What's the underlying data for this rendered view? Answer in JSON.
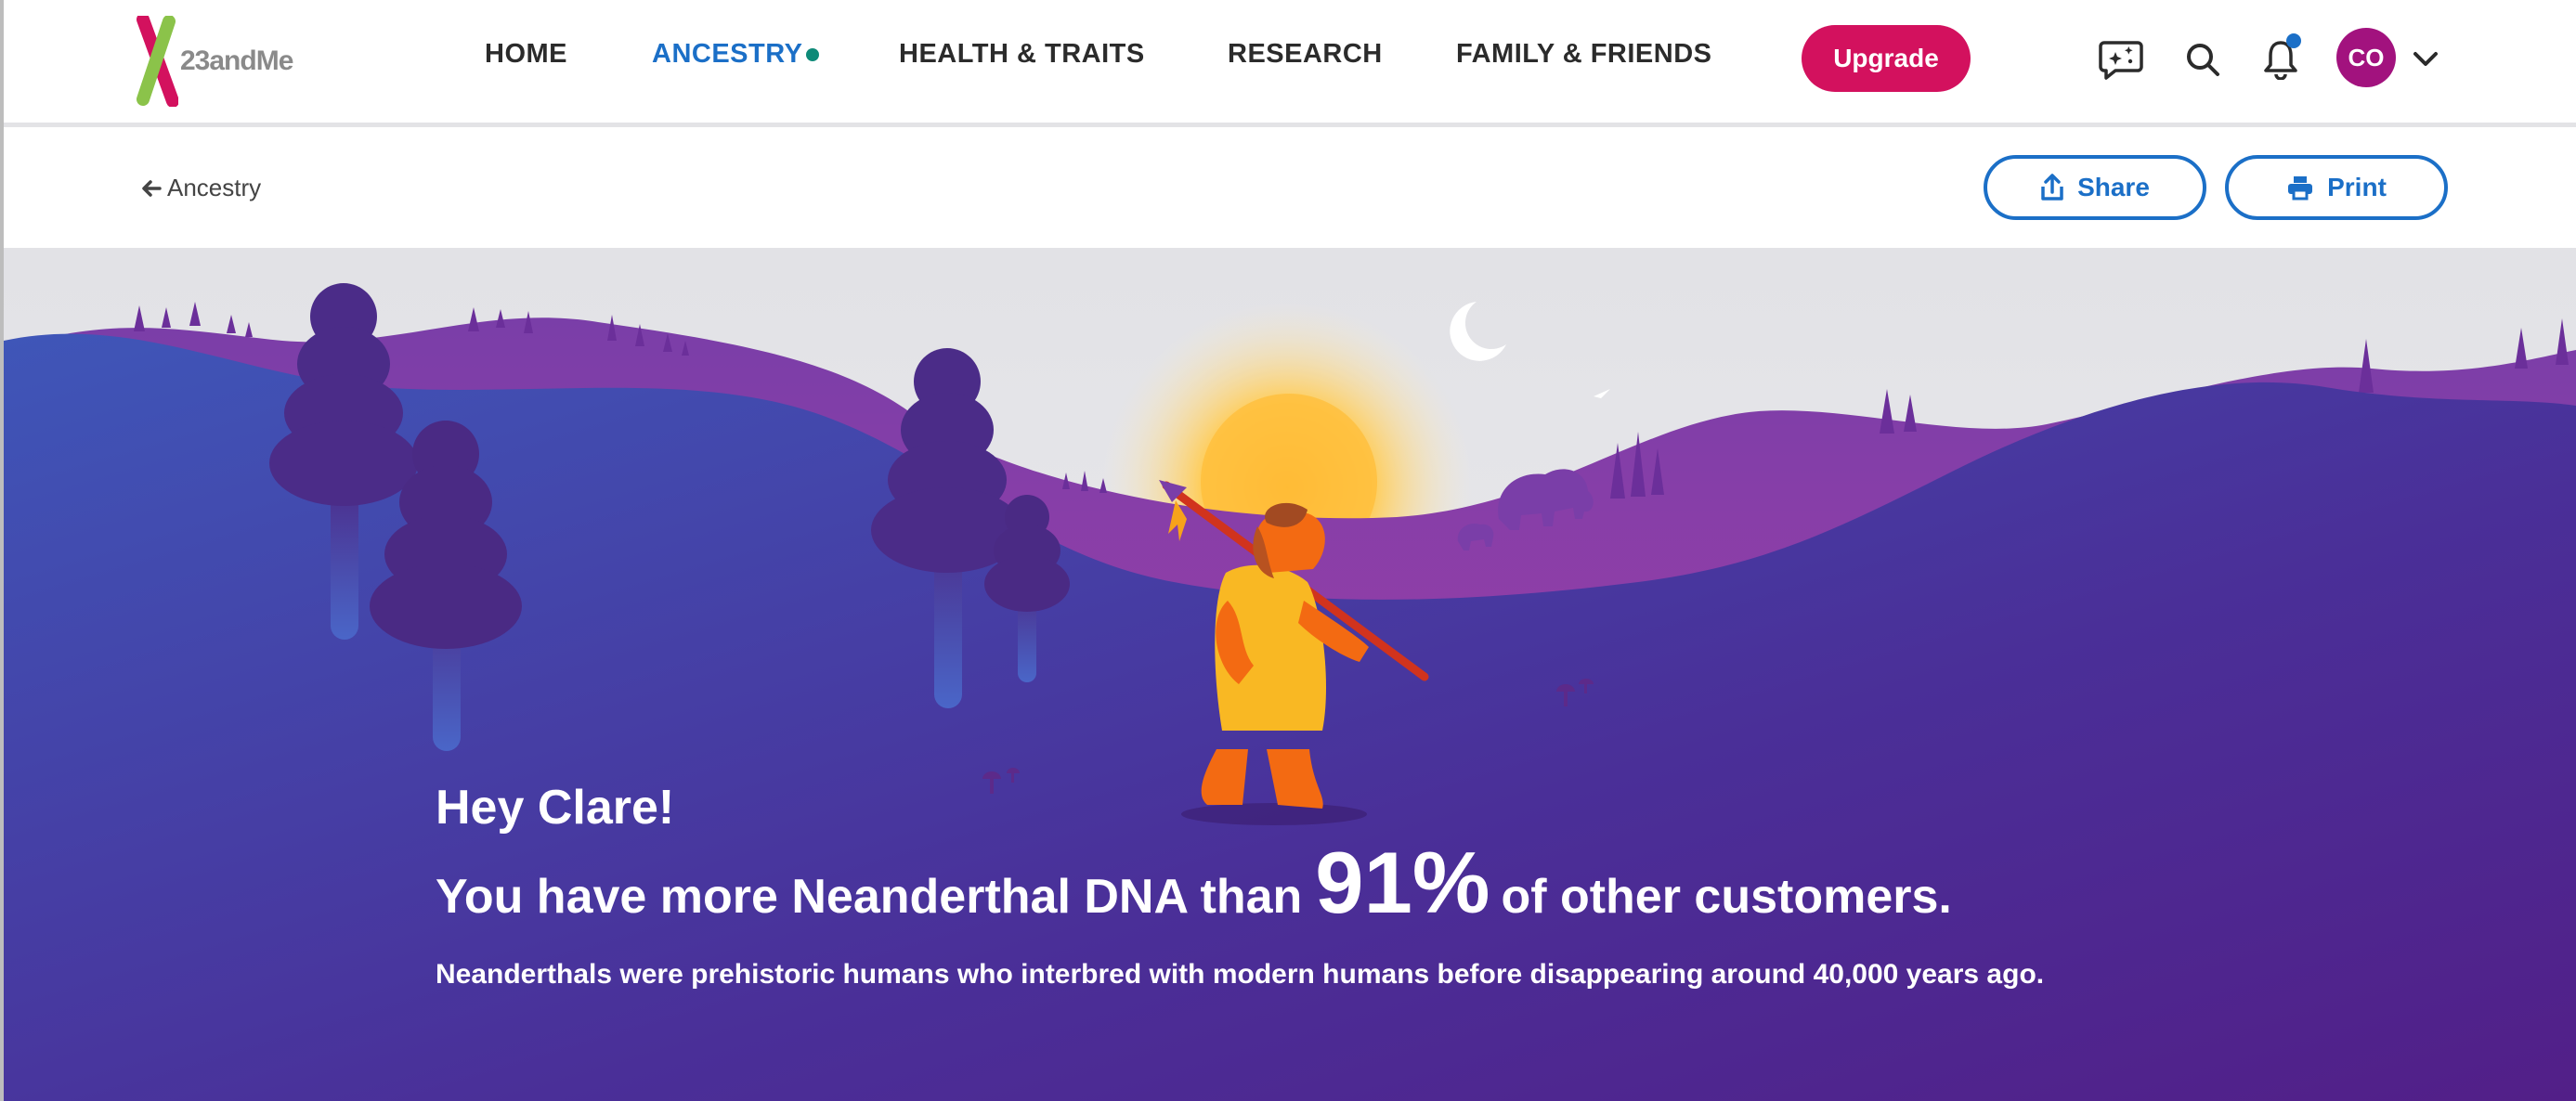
{
  "brand": {
    "name": "23andMe"
  },
  "nav": {
    "home": "HOME",
    "ancestry": "ANCESTRY",
    "health": "HEALTH & TRAITS",
    "research": "RESEARCH",
    "family": "FAMILY & FRIENDS",
    "upgrade": "Upgrade"
  },
  "user": {
    "initials": "CO"
  },
  "icons": [
    "chat-sparkle-icon",
    "search-icon",
    "bell-icon",
    "chevron-down-icon",
    "arrow-left-icon",
    "share-icon",
    "print-icon"
  ],
  "subheader": {
    "back": "Ancestry",
    "share": "Share",
    "print": "Print"
  },
  "hero": {
    "greeting": "Hey Clare!",
    "headline_pre": "You have more Neanderthal DNA than",
    "percent": "91%",
    "headline_post": "of other customers.",
    "description": "Neanderthals were prehistoric humans who interbred with modern humans before disappearing around 40,000 years ago."
  },
  "colors": {
    "active_nav": "#1b6fc7",
    "upgrade": "#d3115e",
    "avatar": "#a2127e",
    "hero_top": "#e5e5e8",
    "hero_bottom": "#4b2286"
  }
}
